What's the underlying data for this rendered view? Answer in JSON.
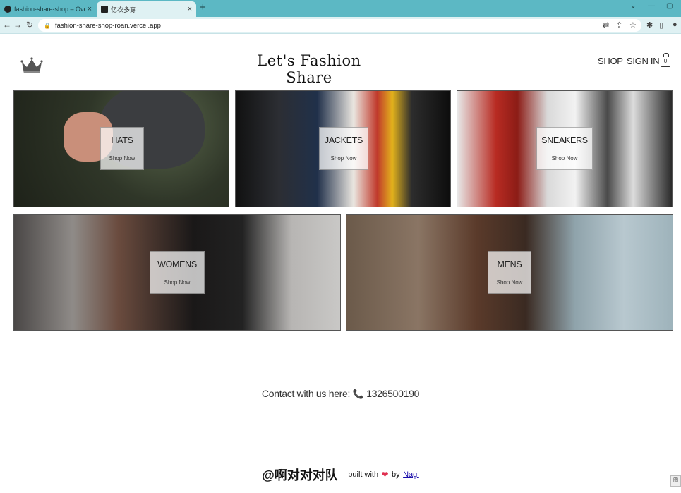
{
  "browser": {
    "tabs": [
      {
        "title": "fashion-share-shop – Overvie",
        "active": false
      },
      {
        "title": "亿衣多穿",
        "active": true
      }
    ],
    "new_tab_symbol": "+",
    "close_symbol": "×",
    "address": "fashion-share-shop-roan.vercel.app",
    "window_controls": [
      "⌄",
      "—",
      "▢"
    ],
    "nav_icons": [
      "back-arrow-icon",
      "forward-arrow-icon",
      "reload-icon"
    ],
    "toolbar_icons": [
      "translate-icon",
      "share-icon",
      "star-icon",
      "extensions-icon",
      "sidebar-icon",
      "profile-icon"
    ]
  },
  "header": {
    "logo": "crown-icon",
    "brand": "Let's Fashion Share",
    "nav": {
      "shop": "SHOP",
      "sign_in": "SIGN IN"
    },
    "cart_count": "0"
  },
  "categories": [
    {
      "name": "HATS",
      "cta": "Shop Now",
      "bg": "#3a4032"
    },
    {
      "name": "JACKETS",
      "cta": "Shop Now",
      "bg": "#1e1c1a"
    },
    {
      "name": "SNEAKERS",
      "cta": "Shop Now",
      "bg": "#a9a9a9"
    },
    {
      "name": "WOMENS",
      "cta": "Shop Now",
      "bg": "#6f6a66"
    },
    {
      "name": "MENS",
      "cta": "Shop Now",
      "bg": "#7c8c93"
    }
  ],
  "contact": {
    "text": "Contact with us here:",
    "phone_icon": "phone-icon",
    "number": "1326500190"
  },
  "footer": {
    "team": "@啊对对对队",
    "built": "built with",
    "heart": "heart-icon",
    "by": "by",
    "author": "Nagi"
  },
  "corner_badge": "图"
}
